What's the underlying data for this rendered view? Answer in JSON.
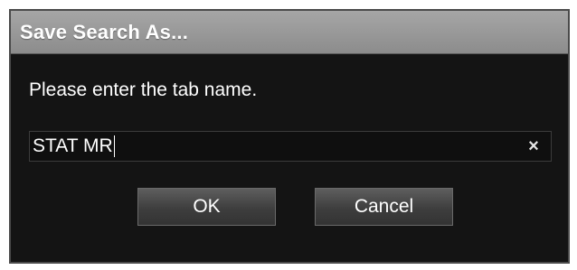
{
  "dialog": {
    "title": "Save Search As...",
    "prompt": "Please enter the tab name.",
    "input": {
      "value": "STAT MR",
      "clear_icon": "close-icon",
      "clear_glyph": "×"
    },
    "buttons": {
      "ok_label": "OK",
      "cancel_label": "Cancel"
    }
  },
  "colors": {
    "dialog_background": "#141414",
    "titlebar": "#999999",
    "text": "#ffffff"
  }
}
